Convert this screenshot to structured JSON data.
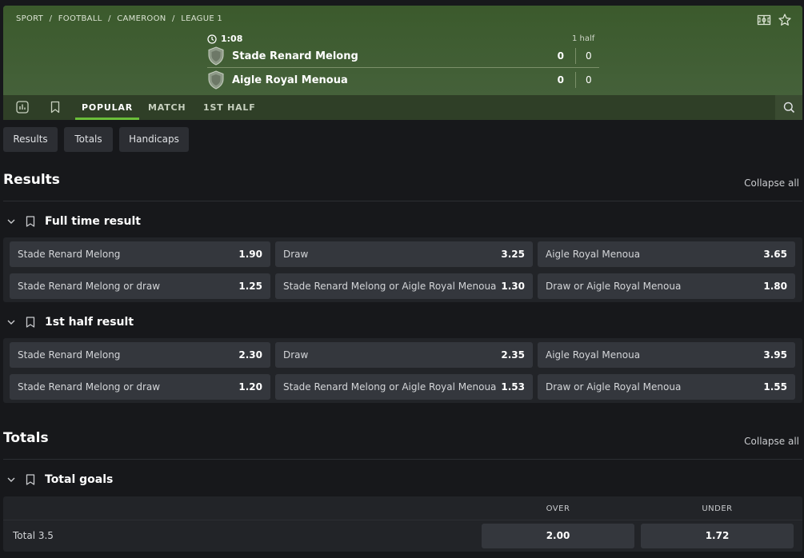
{
  "breadcrumb": [
    "SPORT",
    "/",
    "FOOTBALL",
    "/",
    "CAMEROON",
    "/",
    "LEAGUE 1"
  ],
  "match": {
    "time": "1:08",
    "half_label": "1 half",
    "team1": {
      "name": "Stade Renard Melong",
      "score": "0",
      "half_score": "0"
    },
    "team2": {
      "name": "Aigle Royal Menoua",
      "score": "0",
      "half_score": "0"
    }
  },
  "tabs": [
    {
      "label": "POPULAR",
      "active": true
    },
    {
      "label": "MATCH",
      "active": false
    },
    {
      "label": "1ST HALF",
      "active": false
    }
  ],
  "filters": [
    "Results",
    "Totals",
    "Handicaps"
  ],
  "sections": {
    "results": {
      "title": "Results",
      "collapse": "Collapse all",
      "markets": [
        {
          "title": "Full time result",
          "odds": [
            {
              "label": "Stade Renard Melong",
              "value": "1.90"
            },
            {
              "label": "Draw",
              "value": "3.25"
            },
            {
              "label": "Aigle Royal Menoua",
              "value": "3.65"
            },
            {
              "label": "Stade Renard Melong or draw",
              "value": "1.25"
            },
            {
              "label": "Stade Renard Melong or Aigle Royal Menoua",
              "value": "1.30"
            },
            {
              "label": "Draw or Aigle Royal Menoua",
              "value": "1.80"
            }
          ]
        },
        {
          "title": "1st half result",
          "odds": [
            {
              "label": "Stade Renard Melong",
              "value": "2.30"
            },
            {
              "label": "Draw",
              "value": "2.35"
            },
            {
              "label": "Aigle Royal Menoua",
              "value": "3.95"
            },
            {
              "label": "Stade Renard Melong or draw",
              "value": "1.20"
            },
            {
              "label": "Stade Renard Melong or Aigle Royal Menoua",
              "value": "1.53"
            },
            {
              "label": "Draw or Aigle Royal Menoua",
              "value": "1.55"
            }
          ]
        }
      ]
    },
    "totals": {
      "title": "Totals",
      "collapse": "Collapse all",
      "market": {
        "title": "Total goals",
        "col_over": "OVER",
        "col_under": "UNDER",
        "rows": [
          {
            "label": "Total 3.5",
            "over": "2.00",
            "under": "1.72"
          }
        ]
      }
    }
  },
  "icons": {
    "field": "football-field-icon",
    "favorite": "star-icon",
    "stats": "stats-icon",
    "bookmark": "bookmark-icon",
    "search": "search-icon",
    "clock": "clock-icon",
    "team_badge": "shield-icon",
    "collapse": "chevron-down-icon"
  },
  "colors": {
    "header": "#3d5230",
    "accent": "#6bbf3a",
    "odd_bg": "#34373d"
  }
}
